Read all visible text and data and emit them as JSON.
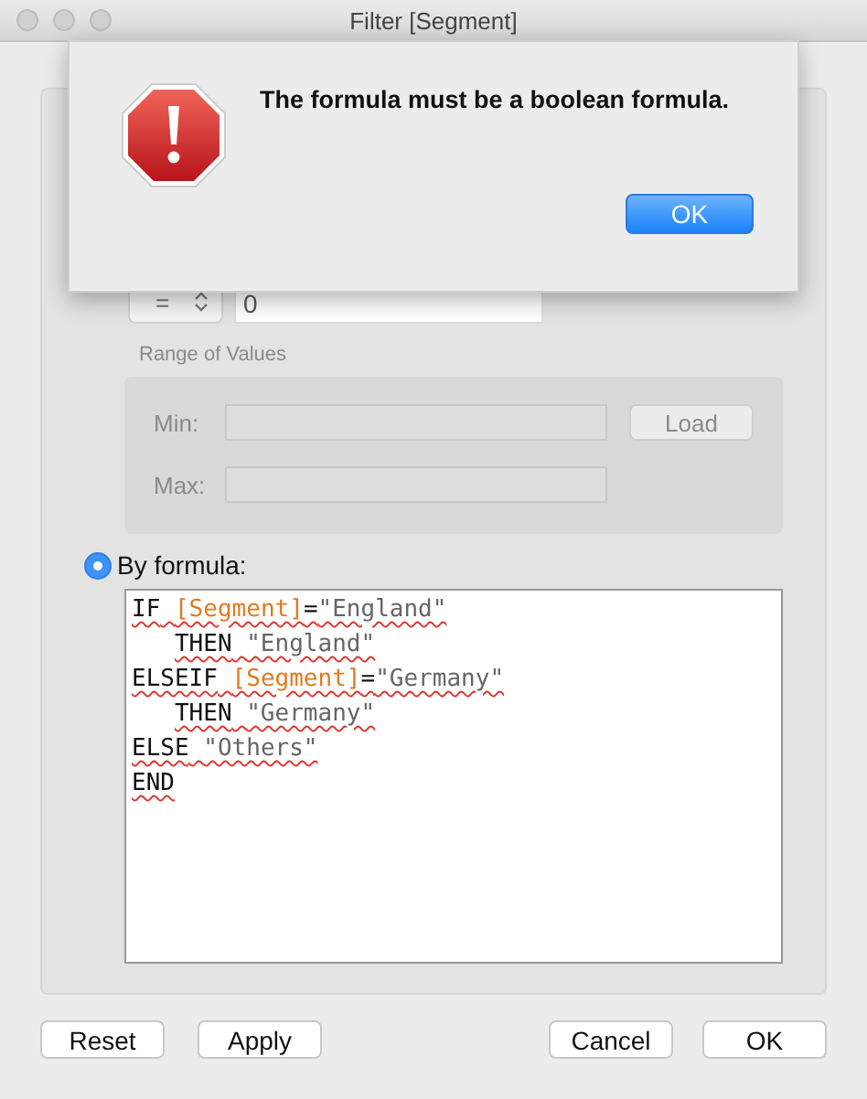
{
  "window": {
    "title": "Filter [Segment]"
  },
  "condition": {
    "operator": "=",
    "value": "0"
  },
  "range": {
    "label": "Range of Values",
    "min_label": "Min:",
    "max_label": "Max:",
    "load_button": "Load",
    "disabled": true
  },
  "formula_option": {
    "label": "By formula:",
    "selected": true
  },
  "formula": {
    "spellcheck_marked": true,
    "lines": [
      {
        "indented": false,
        "words": [
          [
            {
              "kind": "keyword",
              "text": "IF"
            }
          ],
          [
            {
              "kind": "field",
              "text": "[Segment]"
            },
            {
              "kind": "op",
              "text": "="
            },
            {
              "kind": "string",
              "text": "\"England\""
            }
          ]
        ]
      },
      {
        "indented": true,
        "words": [
          [
            {
              "kind": "keyword",
              "text": "THEN"
            }
          ],
          [
            {
              "kind": "string",
              "text": "\"England\""
            }
          ]
        ]
      },
      {
        "indented": false,
        "words": [
          [
            {
              "kind": "keyword",
              "text": "ELSEIF"
            }
          ],
          [
            {
              "kind": "field",
              "text": "[Segment]"
            },
            {
              "kind": "op",
              "text": "="
            },
            {
              "kind": "string",
              "text": "\"Germany\""
            }
          ]
        ]
      },
      {
        "indented": true,
        "words": [
          [
            {
              "kind": "keyword",
              "text": "THEN"
            }
          ],
          [
            {
              "kind": "string",
              "text": "\"Germany\""
            }
          ]
        ]
      },
      {
        "indented": false,
        "words": [
          [
            {
              "kind": "keyword",
              "text": "ELSE"
            }
          ],
          [
            {
              "kind": "string",
              "text": "\"Others\""
            }
          ]
        ]
      },
      {
        "indented": false,
        "words": [
          [
            {
              "kind": "keyword",
              "text": "END"
            }
          ]
        ]
      }
    ]
  },
  "buttons": {
    "left": [
      "Reset",
      "Apply"
    ],
    "right": [
      "Cancel",
      "OK"
    ]
  },
  "alert": {
    "kind": "error",
    "message": "The formula must be a boolean formula.",
    "button": "OK"
  }
}
